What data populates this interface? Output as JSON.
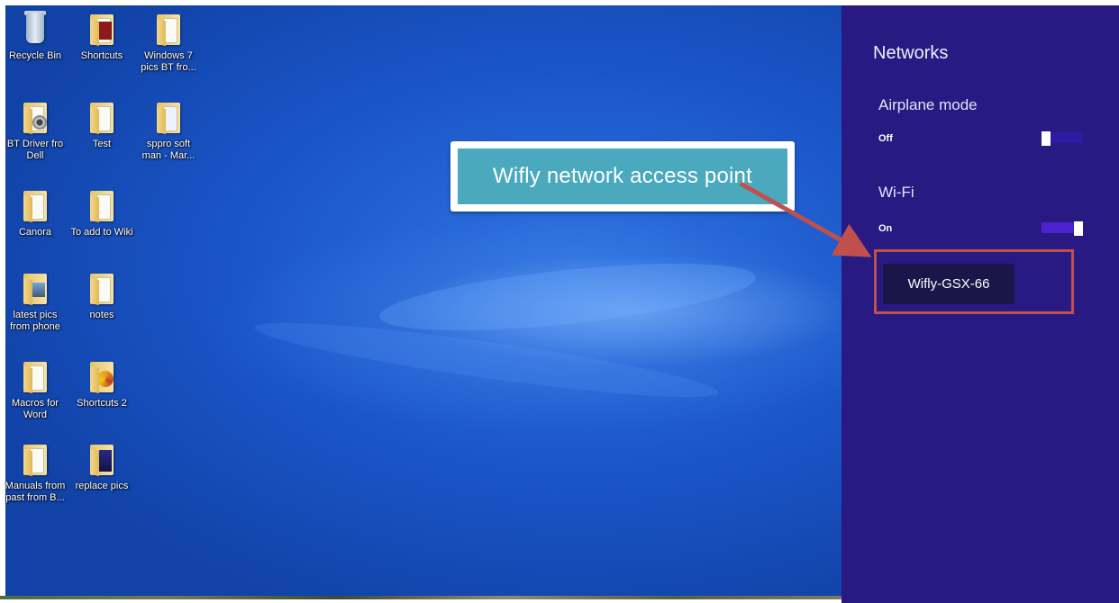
{
  "desktop": {
    "icons": [
      {
        "label": "Recycle Bin",
        "icon": "recycle-bin-icon"
      },
      {
        "label": "Shortcuts",
        "icon": "folder-icon"
      },
      {
        "label": "Windows 7 pics BT fro...",
        "icon": "folder-icon"
      },
      {
        "label": "BT Driver fro Dell",
        "icon": "folder-icon"
      },
      {
        "label": "Test",
        "icon": "folder-icon"
      },
      {
        "label": "sppro soft man - Mar...",
        "icon": "folder-icon"
      },
      {
        "label": "Canora",
        "icon": "folder-icon"
      },
      {
        "label": "To add to Wiki",
        "icon": "folder-icon"
      },
      {
        "label": "latest pics from phone",
        "icon": "folder-icon"
      },
      {
        "label": "notes",
        "icon": "folder-icon"
      },
      {
        "label": "Macros for Word",
        "icon": "folder-icon"
      },
      {
        "label": "Shortcuts 2",
        "icon": "folder-icon"
      },
      {
        "label": "Manuals from past from B...",
        "icon": "folder-icon"
      },
      {
        "label": "replace pics",
        "icon": "folder-icon"
      }
    ]
  },
  "callout": {
    "text": "Wifly network access point"
  },
  "networks_panel": {
    "title": "Networks",
    "airplane_mode": {
      "label": "Airplane mode",
      "state": "Off"
    },
    "wifi": {
      "label": "Wi-Fi",
      "state": "On"
    },
    "networks": [
      {
        "name": "Wifly-GSX-66"
      }
    ]
  },
  "colors": {
    "panel_bg": "#281a82",
    "callout_bg": "#4aa9bd",
    "highlight_border": "#c0504d",
    "arrow": "#c0504d",
    "network_item_bg": "#1b1549"
  }
}
